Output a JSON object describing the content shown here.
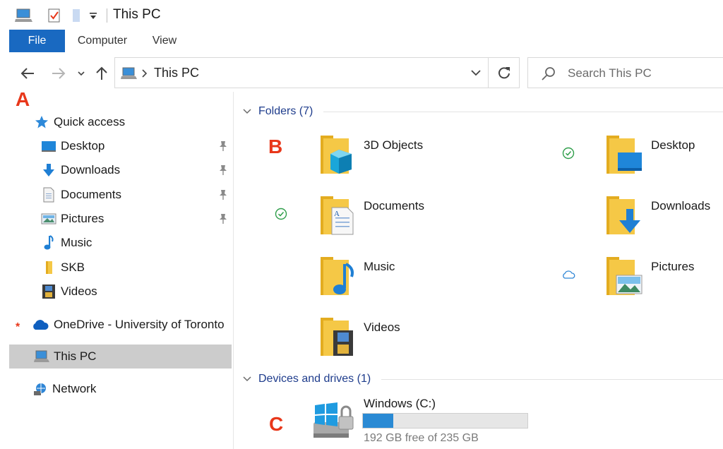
{
  "window": {
    "title": "This PC"
  },
  "ribbon": {
    "tabs": [
      "File",
      "Computer",
      "View"
    ]
  },
  "address": {
    "path": "This PC"
  },
  "search": {
    "placeholder": "Search This PC"
  },
  "annotations": {
    "a": "A",
    "b": "B",
    "c": "C",
    "single_star": "*",
    "double_star": "**"
  },
  "nav": {
    "quick_access": "Quick access",
    "items": [
      {
        "label": "Desktop",
        "pinned": true
      },
      {
        "label": "Downloads",
        "pinned": true
      },
      {
        "label": "Documents",
        "pinned": true
      },
      {
        "label": "Pictures",
        "pinned": true
      },
      {
        "label": "Music",
        "pinned": false
      },
      {
        "label": "SKB",
        "pinned": false
      },
      {
        "label": "Videos",
        "pinned": false
      }
    ],
    "onedrive": "OneDrive - University of Toronto",
    "this_pc": "This PC",
    "network": "Network"
  },
  "content": {
    "folders_header": "Folders (7)",
    "folders": [
      {
        "label": "3D Objects",
        "status": "none"
      },
      {
        "label": "Desktop",
        "status": "synced"
      },
      {
        "label": "Documents",
        "status": "synced"
      },
      {
        "label": "Downloads",
        "status": "none"
      },
      {
        "label": "Music",
        "status": "none"
      },
      {
        "label": "Pictures",
        "status": "cloud"
      },
      {
        "label": "Videos",
        "status": "none"
      }
    ],
    "devices_header": "Devices and drives (1)",
    "drive": {
      "label": "Windows (C:)",
      "free_text": "192 GB free of 235 GB",
      "used_fraction": 0.183
    }
  },
  "colors": {
    "accent": "#1969c1",
    "annotation": "#e8371a",
    "folder": "#f5c846",
    "drive_fill": "#2a8ad4"
  }
}
